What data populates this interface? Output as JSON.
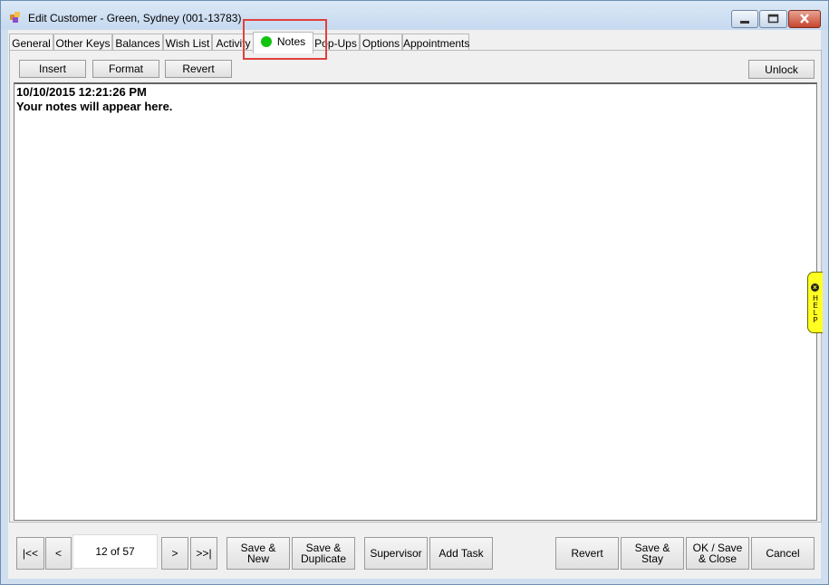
{
  "window": {
    "title": "Edit Customer - Green, Sydney (001-13783)",
    "icons": [
      "app-icon",
      "minimize-icon",
      "maximize-icon",
      "close-icon"
    ]
  },
  "tabs": [
    {
      "label": "General"
    },
    {
      "label": "Other Keys"
    },
    {
      "label": "Balances"
    },
    {
      "label": "Wish List"
    },
    {
      "label": "Activity"
    },
    {
      "label": "Notes",
      "active": true,
      "indicator_color": "#11c40f"
    },
    {
      "label": "Pop-Ups"
    },
    {
      "label": "Options"
    },
    {
      "label": "Appointments"
    }
  ],
  "notes_toolbar": {
    "insert": "Insert",
    "format": "Format",
    "revert": "Revert",
    "unlock": "Unlock"
  },
  "notes": {
    "timestamp": "10/10/2015 12:21:26 PM",
    "text": "Your notes will appear here."
  },
  "help_tab": {
    "letters": "HELP",
    "color": "#ffff22"
  },
  "highlight_color": "#e0403c",
  "nav": {
    "first": "|<<",
    "prev": "<",
    "record": "12 of 57",
    "next": ">",
    "last": ">>|"
  },
  "footer": {
    "save_new_line1": "Save &",
    "save_new_line2": "New",
    "save_dup_line1": "Save &",
    "save_dup_line2": "Duplicate",
    "supervisor": "Supervisor",
    "add_task": "Add Task",
    "revert": "Revert",
    "save_stay_line1": "Save &",
    "save_stay_line2": "Stay",
    "ok_save_close_line1": "OK / Save",
    "ok_save_close_line2": "& Close",
    "cancel": "Cancel"
  }
}
